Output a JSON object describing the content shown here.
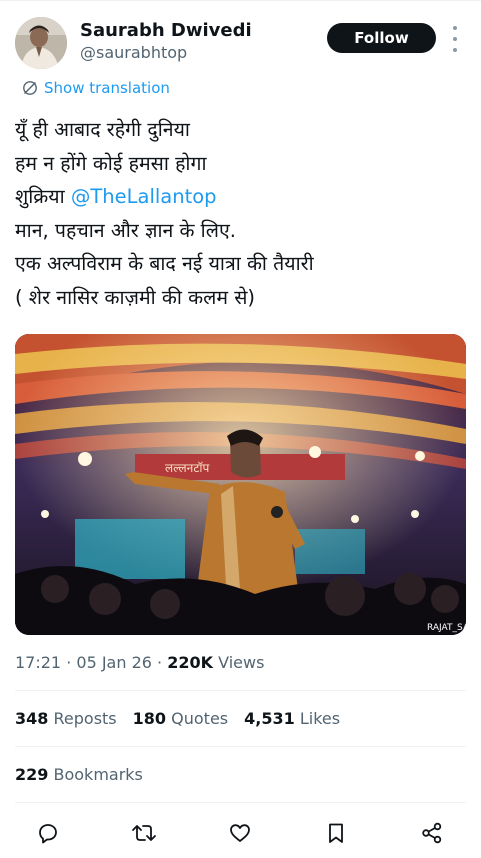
{
  "author": {
    "name": "Saurabh Dwivedi",
    "handle": "@saurabhtop",
    "avatar_icon": "avatar-photo"
  },
  "follow_label": "Follow",
  "translation_label": "Show translation",
  "tweet": {
    "line1": "यूँ ही आबाद रहेगी दुनिया",
    "line2": "हम न होंगे कोई हमसा होगा",
    "line3_prefix": "शुक्रिया ",
    "mention": "@TheLallantop",
    "line4": "मान, पहचान और ज्ञान के लिए.",
    "line5": "एक अल्पविराम के बाद नई यात्रा की तैयारी",
    "line6": "( शेर नासिर काज़मी की कलम से)"
  },
  "media": {
    "stage_banner_text": "लल्लनटॉप",
    "watermark": "RAJAT_SAI"
  },
  "meta": {
    "time": "17:21",
    "date": "05 Jan 26",
    "views_count": "220K",
    "views_label": "Views",
    "separator": "·"
  },
  "stats": {
    "reposts_count": "348",
    "reposts_label": "Reposts",
    "quotes_count": "180",
    "quotes_label": "Quotes",
    "likes_count": "4,531",
    "likes_label": "Likes",
    "bookmarks_count": "229",
    "bookmarks_label": "Bookmarks"
  },
  "actions": [
    "reply-icon",
    "repost-icon",
    "like-icon",
    "bookmark-icon",
    "share-icon"
  ],
  "colors": {
    "accent": "#1d9bf0",
    "text": "#0f1419",
    "secondary": "#536471",
    "button_bg": "#0f1419"
  }
}
